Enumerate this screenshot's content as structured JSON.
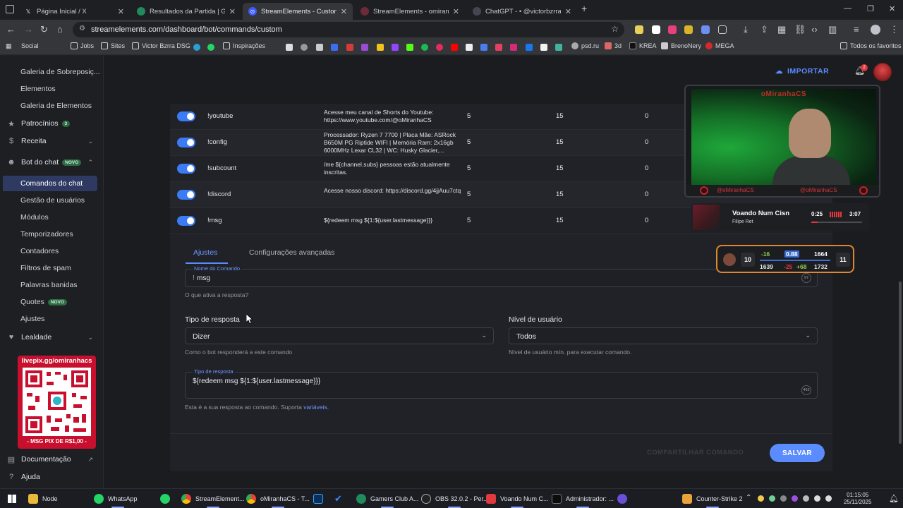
{
  "browser": {
    "tabs": [
      {
        "title": "Página Inicial / X",
        "icon": "x-logo-icon",
        "color": "#000000"
      },
      {
        "title": "Resultados da Partida | Gamers",
        "icon": "gamersclub-icon",
        "color": "#1f8a5a"
      },
      {
        "title": "StreamElements - Custom comm",
        "icon": "streamelements-icon",
        "color": "#3d5afe"
      },
      {
        "title": "StreamElements - omiranhacs",
        "icon": "streamelements-icon",
        "color": "#6f2a3a"
      },
      {
        "title": "ChatGPT - • @victorbzrra",
        "icon": "chatgpt-icon",
        "color": "#444654"
      }
    ],
    "url": "streamelements.com/dashboard/bot/commands/custom",
    "bookmarks": [
      "Social",
      "Jobs",
      "Sites",
      "Victor Bzrra DSG",
      "Inspirações",
      "psd.ru",
      "3d",
      "KREA",
      "BrenoNery",
      "MEGA"
    ],
    "all_bookmarks_label": "Todos os favoritos"
  },
  "sidebar": {
    "items": [
      {
        "label": "Galeria de Sobreposiç...",
        "type": "sub"
      },
      {
        "label": "Elementos",
        "type": "sub"
      },
      {
        "label": "Galeria de Elementos",
        "type": "sub"
      },
      {
        "label": "Patrocínios",
        "type": "top",
        "badge": "3",
        "icon": "star-icon"
      },
      {
        "label": "Receita",
        "type": "top",
        "icon": "dollar-icon",
        "chevron": "down"
      },
      {
        "label": "Bot do chat",
        "type": "top",
        "badge": "NOVO",
        "icon": "robot-icon",
        "chevron": "up"
      },
      {
        "label": "Comandos do chat",
        "type": "active"
      },
      {
        "label": "Gestão de usuários",
        "type": "sub"
      },
      {
        "label": "Módulos",
        "type": "sub"
      },
      {
        "label": "Temporizadores",
        "type": "sub"
      },
      {
        "label": "Contadores",
        "type": "sub"
      },
      {
        "label": "Filtros de spam",
        "type": "sub"
      },
      {
        "label": "Palavras banidas",
        "type": "sub"
      },
      {
        "label": "Quotes",
        "type": "sub",
        "badge": "NOVO"
      },
      {
        "label": "Ajustes",
        "type": "sub"
      },
      {
        "label": "Lealdade",
        "type": "top",
        "icon": "heart-icon",
        "chevron": "down"
      }
    ],
    "qr": {
      "top": "livepix.gg/omiranhacs",
      "bottom": "- MSG PIX DE R$1,00 -"
    },
    "documentation": "Documentação",
    "help": "Ajuda"
  },
  "header": {
    "import_label": "IMPORTAR",
    "notifications": "2"
  },
  "commands": [
    {
      "name": "!youtube",
      "response": "Acesse meu canal de Shorts do Youtube: https://www.youtube.com/@oMiranhaCS",
      "cost": "5",
      "cooldown": "15",
      "uses": "0"
    },
    {
      "name": "!config",
      "response": "Processador: Ryzen 7 7700 | Placa Mãe: ASRock B650M PG Riptide WIFI | Memória Ram: 2x16gb 6000MHz Lexar CL32 | WC: Husky Glacier,...",
      "cost": "5",
      "cooldown": "15",
      "uses": "0"
    },
    {
      "name": "!subcount",
      "response": "/me ${channel.subs} pessoas estão atualmente inscritas.",
      "cost": "5",
      "cooldown": "15",
      "uses": "0"
    },
    {
      "name": "!discord",
      "response": "Acesse nosso discord: https://discord.gg/4jjAuu7ctq",
      "cost": "5",
      "cooldown": "15",
      "uses": "0"
    },
    {
      "name": "!msg",
      "response": "${redeem msg ${1:${user.lastmessage}}}",
      "cost": "5",
      "cooldown": "15",
      "uses": "0"
    }
  ],
  "editor": {
    "tabs": [
      "Ajustes",
      "Configurações avançadas"
    ],
    "command_name": {
      "label": "Nome do Comando",
      "prefix": "!",
      "value": "msg",
      "count": "97",
      "help": "O que ativa a resposta?"
    },
    "response_type": {
      "title": "Tipo de resposta",
      "value": "Dizer",
      "help": "Como o bot responderá a este comando"
    },
    "user_level": {
      "title": "Nível de usuário",
      "value": "Todos",
      "help": "Nível de usuário mín. para executar comando."
    },
    "response": {
      "label": "Tipo de resposta",
      "value": "${redeem msg ${1:${user.lastmessage}}}",
      "count": "463",
      "help": "Esta é a sua resposta ao comando. Suporta",
      "help_link": "variáveis",
      "help_end": "."
    },
    "share_label": "COMPARTILHAR COMANDO",
    "save_label": "SALVAR"
  },
  "overlay": {
    "cam_title": "oMiranhaCS",
    "handle_left": "@oMiranhaCS",
    "handle_right": "@oMiranhaCS",
    "music": {
      "song": "Voando Num Cisn",
      "artist": "Filipe Ret",
      "elapsed": "0:25",
      "total": "3:07",
      "progress": 0.13
    },
    "stats": {
      "left_box": "10",
      "right_box": "11",
      "top_left": "-16",
      "top_mid": "0.88",
      "top_right": "1664",
      "bot_left": "1639",
      "bot_mid1": "-25",
      "bot_mid2": "+68",
      "bot_right": "1732"
    }
  },
  "taskbar": {
    "apps": [
      "Node",
      "WhatsApp",
      "StreamElement...",
      "oMiranhaCS - T...",
      "Gamers Club A...",
      "OBS 32.0.2 - Per...",
      "Voando Num C...",
      "Administrador: ...",
      "Counter-Strike 2"
    ],
    "time": "01:15:05",
    "date": "25/11/2025"
  }
}
